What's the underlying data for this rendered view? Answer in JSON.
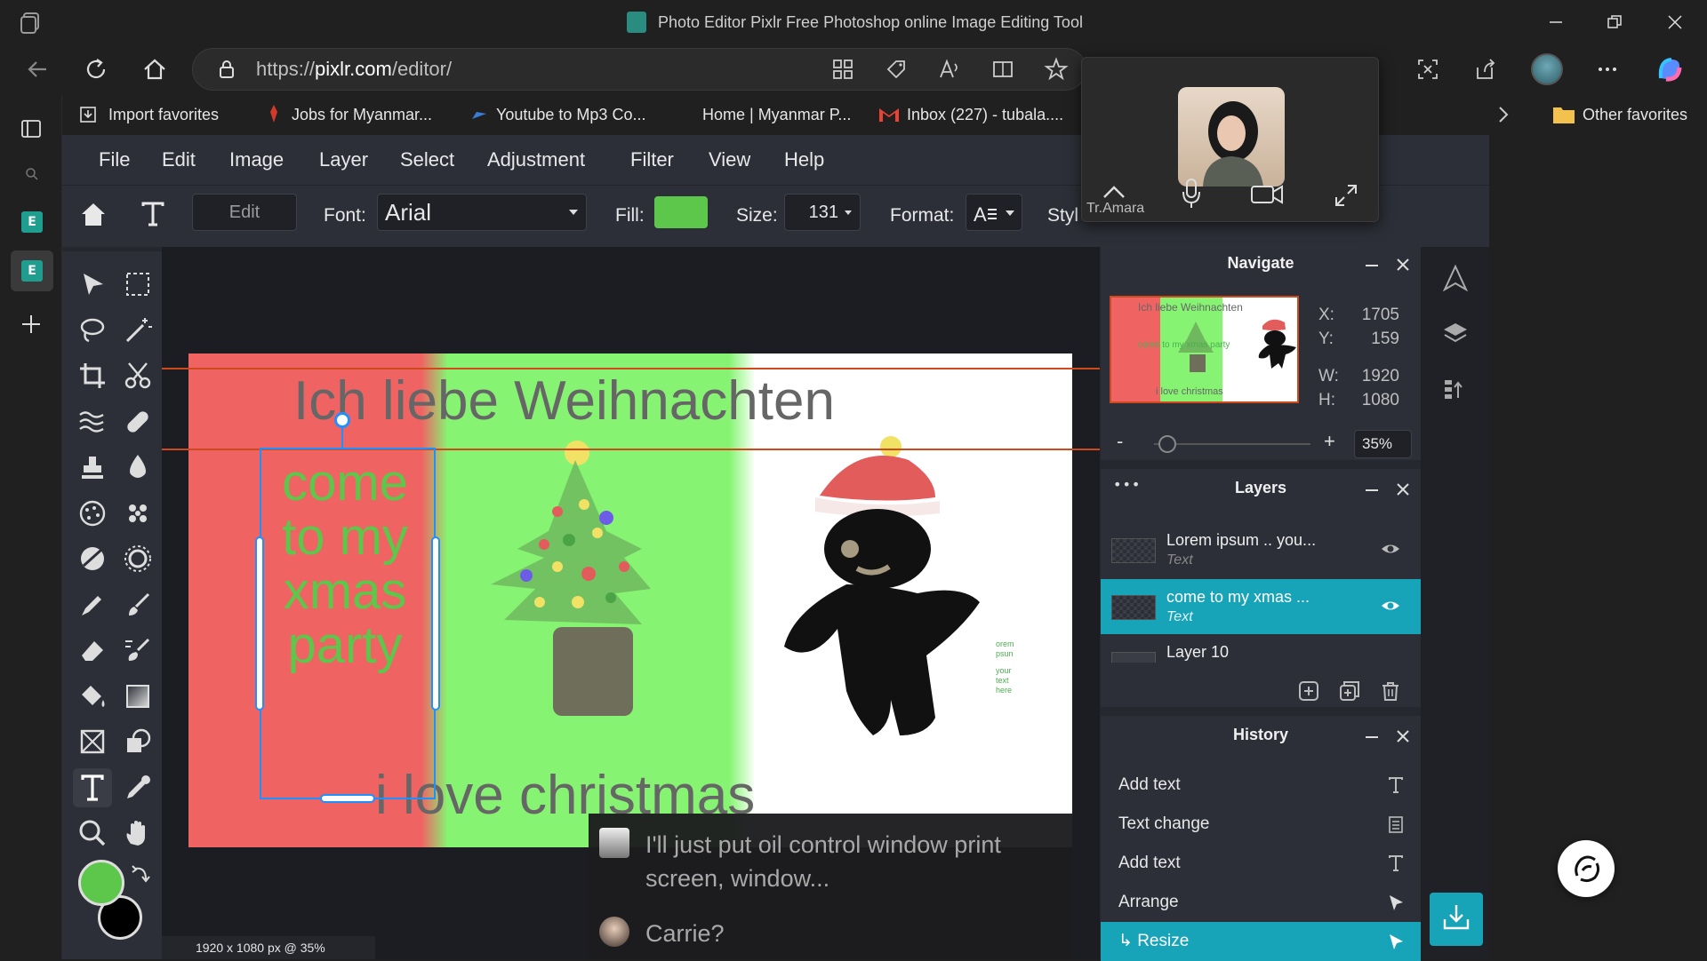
{
  "browser": {
    "window_title": "Photo Editor Pixlr Free Photoshop online Image Editing Tool",
    "url_prefix": "https://",
    "url_domain": "pixlr.com",
    "url_path": "/editor/",
    "favorites": [
      {
        "label": "Import favorites",
        "icon": "import-icon"
      },
      {
        "label": "Jobs for Myanmar...",
        "icon": "pin-icon"
      },
      {
        "label": "Youtube to Mp3 Co...",
        "icon": "arrow-icon"
      },
      {
        "label": "Home | Myanmar P...",
        "icon": "none"
      },
      {
        "label": "Inbox (227) - tubala....",
        "icon": "gmail-icon"
      }
    ],
    "other_favorites": "Other favorites"
  },
  "menu": [
    "File",
    "Edit",
    "Image",
    "Layer",
    "Select",
    "Adjustment",
    "Filter",
    "View",
    "Help"
  ],
  "options": {
    "edit_button": "Edit",
    "font_label": "Font:",
    "font_value": "Arial",
    "fill_label": "Fill:",
    "fill_color": "#5cc74a",
    "size_label": "Size:",
    "size_value": "131",
    "format_label": "Format:",
    "style_label": "Styl"
  },
  "call": {
    "name": "Tr.Amara"
  },
  "canvas": {
    "title_text": "Ich liebe Weihnachten",
    "selected_text": [
      "come",
      "to my",
      "xmas",
      "party"
    ],
    "bottom_text": "i love christmas",
    "small_text": [
      "orem",
      "psun",
      "your",
      "text",
      "here"
    ],
    "panel_colors": [
      "#f06363",
      "#86f472",
      "#ffffff"
    ],
    "text_color": "#666666",
    "selected_text_color": "#5cc74a"
  },
  "status": "1920 x 1080 px @ 35%",
  "navigate": {
    "title": "Navigate",
    "x_label": "X:",
    "x_value": "1705",
    "y_label": "Y:",
    "y_value": "159",
    "w_label": "W:",
    "w_value": "1920",
    "h_label": "H:",
    "h_value": "1080",
    "zoom": "35%",
    "zoom_level": 0.35,
    "minus": "-",
    "plus": "+",
    "thumb_title": "Ich liebe Weihnachten",
    "thumb_mid": "come to my xmas party",
    "thumb_bottom": "i love christmas"
  },
  "layers": {
    "title": "Layers",
    "dots": "•••",
    "items": [
      {
        "name": "Lorem ipsum .. you...",
        "type": "Text"
      },
      {
        "name": "come to my xmas ...",
        "type": "Text"
      },
      {
        "name": "Layer 10",
        "type": ""
      }
    ]
  },
  "history": {
    "title": "History",
    "items": [
      {
        "label": "Add text",
        "icon": "text-icon"
      },
      {
        "label": "Text change",
        "icon": "doc-icon"
      },
      {
        "label": "Add text",
        "icon": "text-icon"
      },
      {
        "label": "Arrange",
        "icon": "pointer-icon"
      },
      {
        "label": "↳ Resize",
        "icon": "pointer-icon"
      }
    ]
  },
  "chat": {
    "messages": [
      "I'll just put oil control window print",
      "screen, window...",
      "Carrie?"
    ]
  },
  "colors": {
    "accent": "#17a3b8",
    "guide_line": "#d0491c",
    "foreground": "#5cc74a",
    "background": "#000000"
  }
}
